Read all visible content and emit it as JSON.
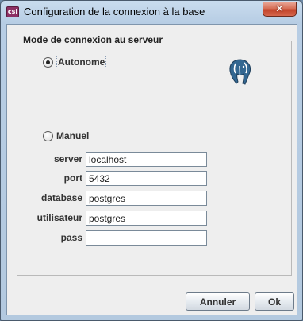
{
  "window": {
    "title": "Configuration de la connexion à la base",
    "app_icon": "csi-app-icon",
    "close_glyph": "✕"
  },
  "group": {
    "title": "Mode de connexion au serveur"
  },
  "modes": {
    "autonome_label": "Autonome",
    "manuel_label": "Manuel",
    "selected": "autonome"
  },
  "fields": {
    "server_label": "server",
    "server_value": "localhost",
    "port_label": "port",
    "port_value": "5432",
    "database_label": "database",
    "database_value": "postgres",
    "user_label": "utilisateur",
    "user_value": "postgres",
    "pass_label": "pass",
    "pass_value": ""
  },
  "buttons": {
    "cancel_label": "Annuler",
    "ok_label": "Ok"
  },
  "colors": {
    "title_bar": "#c9dcee",
    "close_button": "#c2432a",
    "dialog_bg": "#eeeeee",
    "logo_blue": "#336791"
  }
}
